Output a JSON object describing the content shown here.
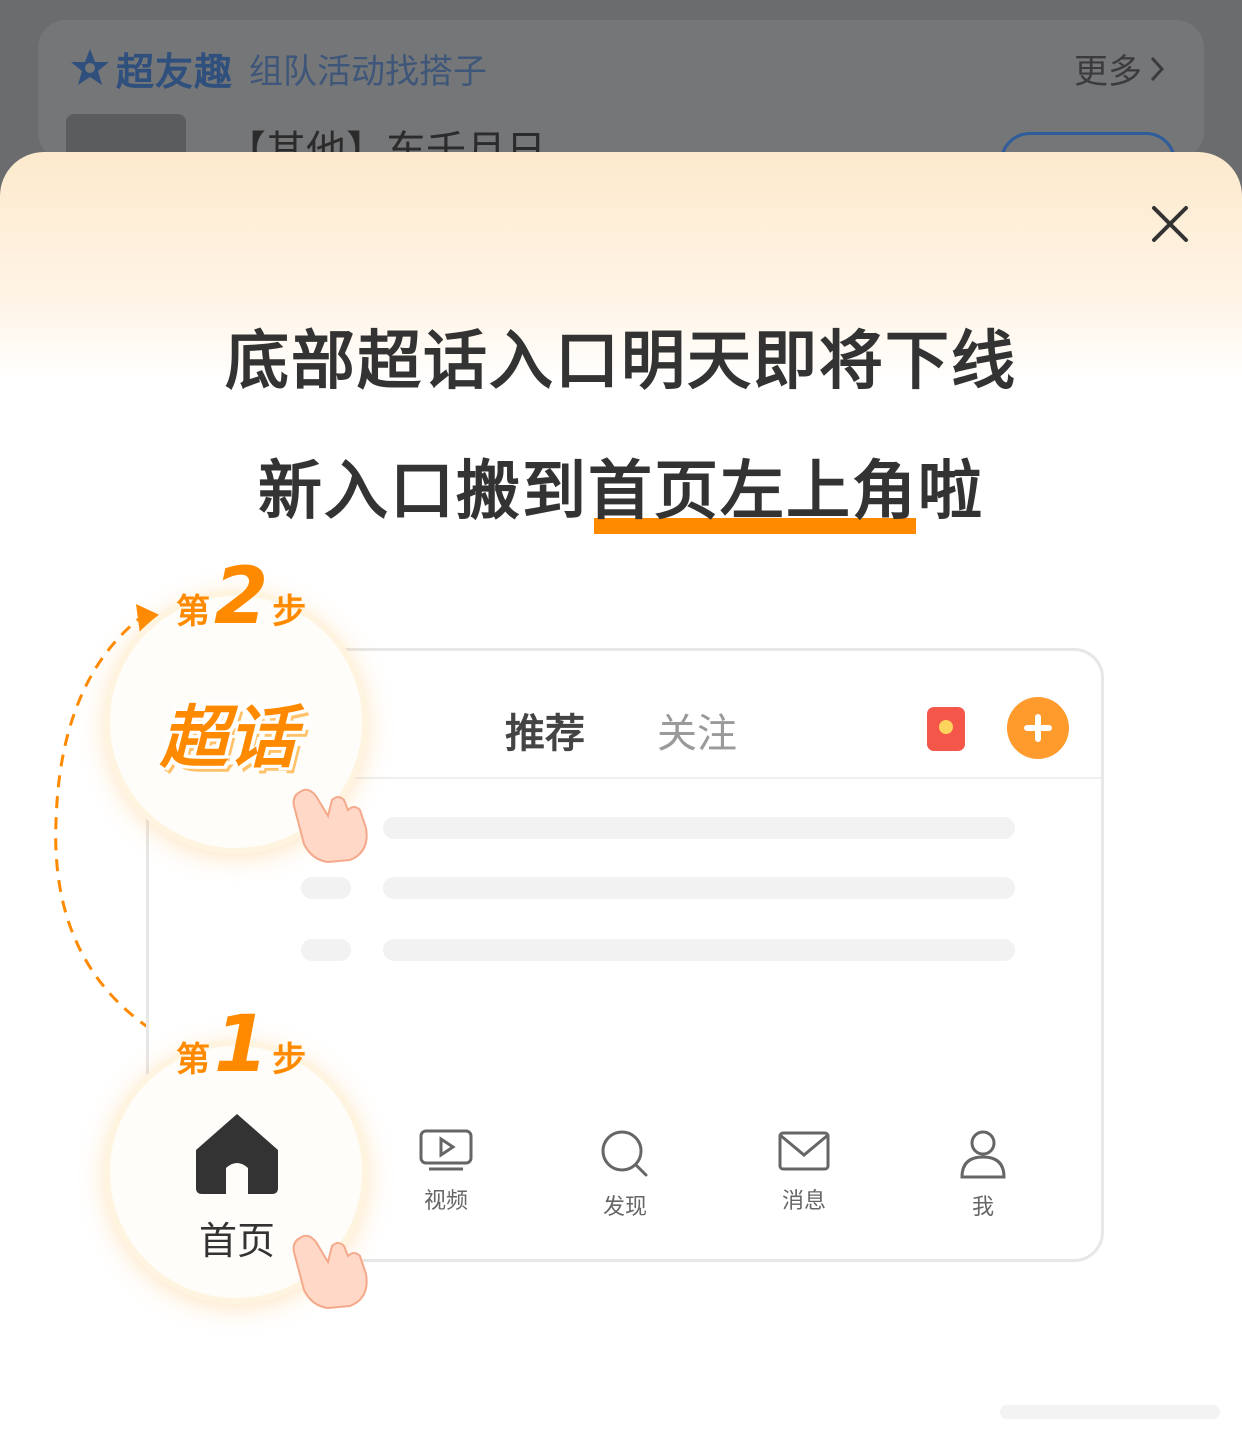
{
  "background": {
    "brand": "超友趣",
    "subtitle": "组队活动找搭子",
    "more": "更多",
    "item_text": "【其他】东千月日"
  },
  "popup": {
    "title_line1": "底部超话入口明天即将下线",
    "title_line2_prefix": "新入口搬到",
    "title_line2_highlight": "首页左上角",
    "title_line2_suffix": "啦",
    "step2": {
      "prefix": "第",
      "num": "2",
      "suffix": "步",
      "logo_text": "超话"
    },
    "step1": {
      "prefix": "第",
      "num": "1",
      "suffix": "步",
      "home_label": "首页"
    },
    "mock": {
      "tabs": [
        "推荐",
        "关注"
      ],
      "nav": [
        "视频",
        "发现",
        "消息",
        "我"
      ]
    }
  }
}
